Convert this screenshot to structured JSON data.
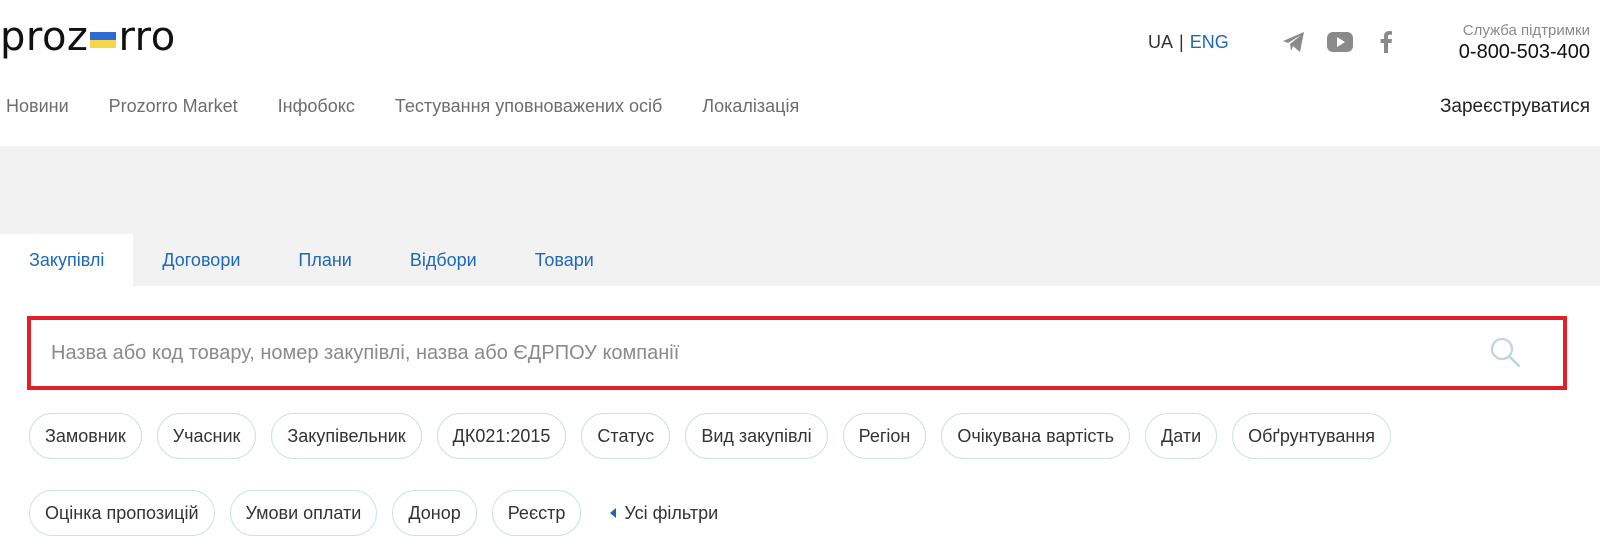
{
  "logo": {
    "text_left": "proz",
    "text_right": "rro"
  },
  "lang": {
    "ua": "UA",
    "separator": "|",
    "eng": "ENG"
  },
  "social": [
    {
      "icon": "telegram-icon"
    },
    {
      "icon": "youtube-icon"
    },
    {
      "icon": "facebook-icon"
    }
  ],
  "support": {
    "label": "Служба підтримки",
    "phone": "0-800-503-400"
  },
  "nav": {
    "items": [
      "Новини",
      "Prozorro Market",
      "Інфобокс",
      "Тестування уповноважених осіб",
      "Локалізація"
    ],
    "register": "Зареєструватися"
  },
  "tabs": [
    "Закупівлі",
    "Договори",
    "Плани",
    "Відбори",
    "Товари"
  ],
  "active_tab": "Закупівлі",
  "search": {
    "placeholder": "Назва або код товару, номер закупівлі, назва або ЄДРПОУ компанії",
    "value": ""
  },
  "filters": {
    "row1": [
      "Замовник",
      "Учасник",
      "Закупівельник",
      "ДК021:2015",
      "Статус",
      "Вид закупівлі",
      "Регіон",
      "Очікувана вартість",
      "Дати",
      "Обґрунтування"
    ],
    "row2": [
      "Оцінка пропозицій",
      "Умови оплати",
      "Донор",
      "Реєстр"
    ],
    "all_filters": "Усі фільтри"
  },
  "colors": {
    "accent_blue": "#1d69b8",
    "highlight_red": "#e21e26",
    "flag_blue": "#2d6dd2",
    "flag_yellow": "#f7d54a",
    "chip_border": "#cfe0e6",
    "gray_band": "#f2f2f2"
  }
}
